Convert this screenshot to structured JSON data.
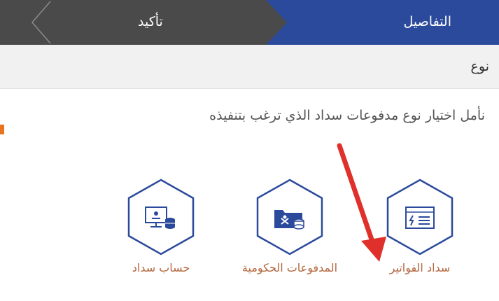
{
  "stepper": {
    "steps": [
      {
        "label": "التفاصيل",
        "state": "active"
      },
      {
        "label": "تأكيد",
        "state": "inactive"
      }
    ],
    "active_color": "#2b4a9b",
    "inactive_color": "#4a4a4a"
  },
  "section": {
    "title": "نوع"
  },
  "instruction": "نأمل اختيار نوع مدفوعات سداد الذي ترغب بتنفيذه",
  "options": [
    {
      "label": "سداد الفواتير",
      "icon": "invoice-icon"
    },
    {
      "label": "المدفوعات الحكومية",
      "icon": "government-payments-icon"
    },
    {
      "label": "حساب سداد",
      "icon": "account-computer-icon"
    }
  ],
  "colors": {
    "hex_border": "#2b4a9b",
    "icon": "#2b4a9b",
    "option_label": "#b4683f",
    "annotation_arrow": "#e0302b"
  }
}
